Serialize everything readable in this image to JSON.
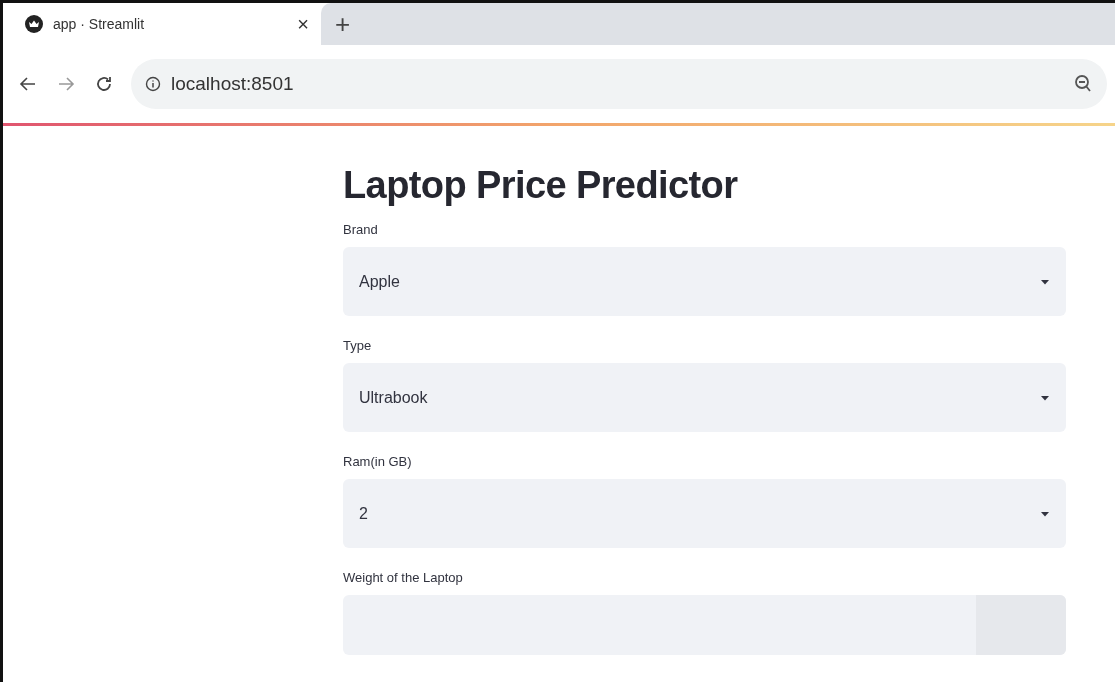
{
  "browser": {
    "tab_title": "app · Streamlit",
    "new_tab": "+",
    "close": "×",
    "url": "localhost:8501"
  },
  "app": {
    "title": "Laptop Price Predictor",
    "fields": [
      {
        "kind": "select",
        "label": "Brand",
        "value": "Apple"
      },
      {
        "kind": "select",
        "label": "Type",
        "value": "Ultrabook"
      },
      {
        "kind": "select",
        "label": "Ram(in GB)",
        "value": "2"
      },
      {
        "kind": "number",
        "label": "Weight of the Laptop"
      }
    ]
  }
}
